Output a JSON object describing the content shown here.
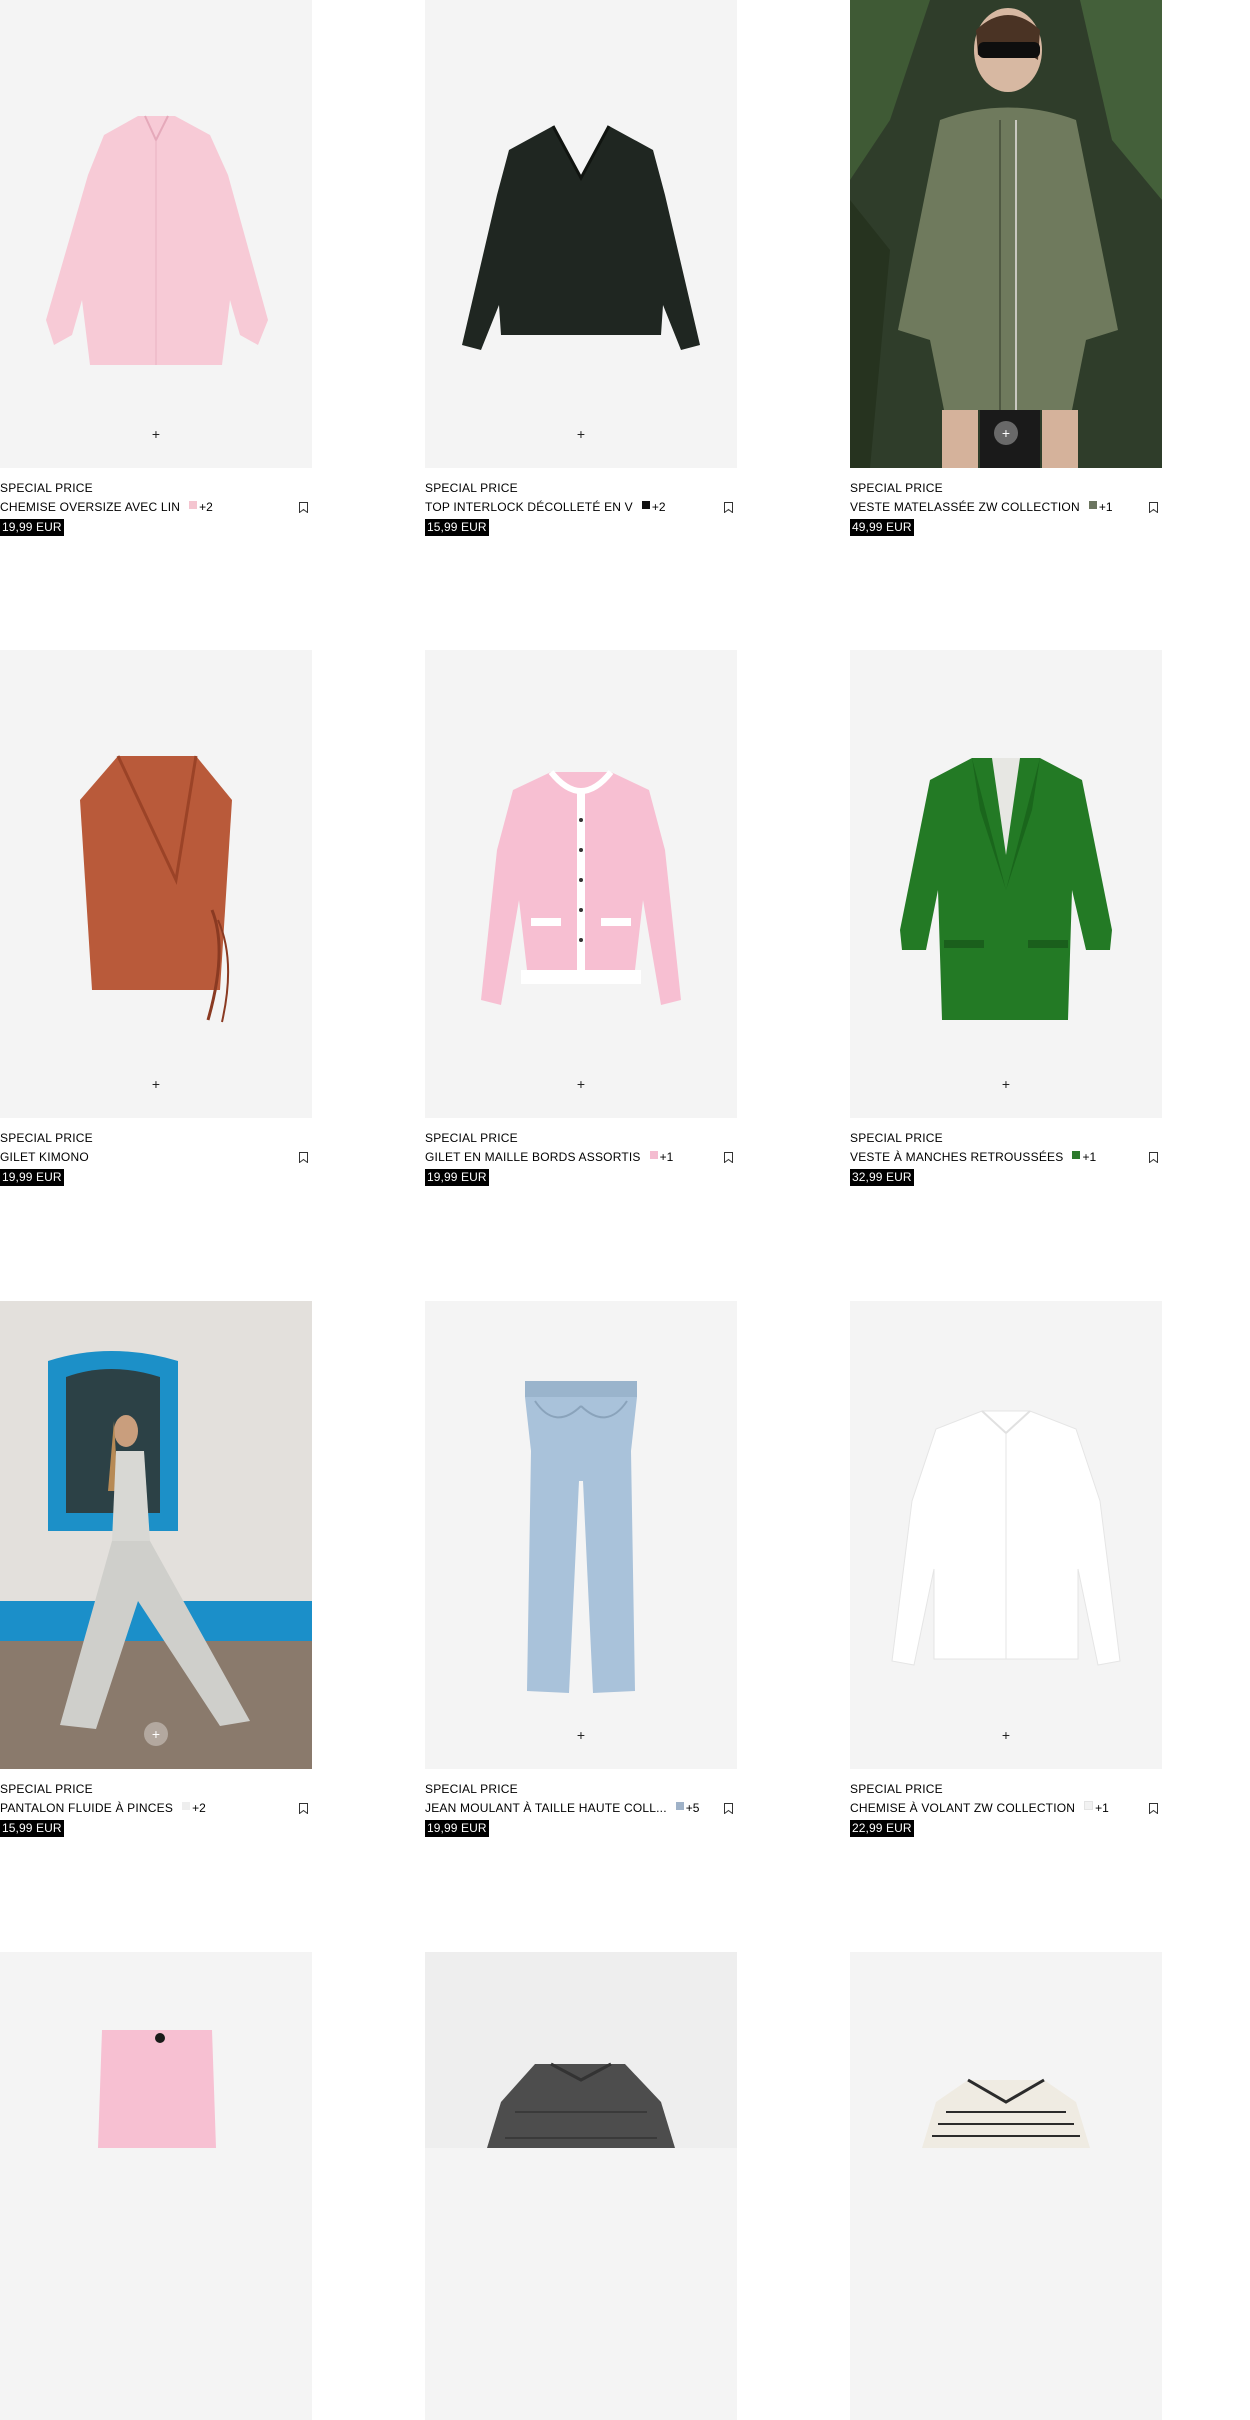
{
  "products": [
    {
      "label": "SPECIAL PRICE",
      "name": "CHEMISE OVERSIZE AVEC LIN",
      "swatch_color": "#f4c5d0",
      "more_colors": "+2",
      "price": "19,99 EUR",
      "image_kind": "pink-shirt",
      "bg": "#f4f4f4"
    },
    {
      "label": "SPECIAL PRICE",
      "name": "TOP INTERLOCK DÉCOLLETÉ EN V",
      "swatch_color": "#111111",
      "more_colors": "+2",
      "price": "15,99 EUR",
      "image_kind": "black-top",
      "bg": "#f4f4f4"
    },
    {
      "label": "SPECIAL PRICE",
      "name": "VESTE MATELASSÉE ZW COLLECTION",
      "swatch_color": "#6b7560",
      "more_colors": "+1",
      "price": "49,99 EUR",
      "image_kind": "model-quilted-jacket",
      "bg": "#3d4a34"
    },
    {
      "label": "SPECIAL PRICE",
      "name": "GILET KIMONO",
      "swatch_color": "",
      "more_colors": "",
      "price": "19,99 EUR",
      "image_kind": "rust-vest",
      "bg": "#f4f4f4"
    },
    {
      "label": "SPECIAL PRICE",
      "name": "GILET EN MAILLE BORDS ASSORTIS",
      "swatch_color": "#f4bcd0",
      "more_colors": "+1",
      "price": "19,99 EUR",
      "image_kind": "pink-cardigan",
      "bg": "#f4f4f4"
    },
    {
      "label": "SPECIAL PRICE",
      "name": "VESTE À MANCHES RETROUSSÉES",
      "swatch_color": "#2d7a2d",
      "more_colors": "+1",
      "price": "32,99 EUR",
      "image_kind": "green-blazer",
      "bg": "#f4f4f4"
    },
    {
      "label": "SPECIAL PRICE",
      "name": "PANTALON FLUIDE À PINCES",
      "swatch_color": "#eeeeee",
      "more_colors": "+2",
      "price": "15,99 EUR",
      "image_kind": "model-wide-pants",
      "bg": "#e8e6e3"
    },
    {
      "label": "SPECIAL PRICE",
      "name": "JEAN MOULANT À TAILLE HAUTE COLL...",
      "swatch_color": "#9fb2c8",
      "more_colors": "+5",
      "price": "19,99 EUR",
      "image_kind": "jeans",
      "bg": "#f4f4f4"
    },
    {
      "label": "SPECIAL PRICE",
      "name": "CHEMISE À VOLANT ZW COLLECTION",
      "swatch_color": "#f2f2f2",
      "more_colors": "+1",
      "price": "22,99 EUR",
      "image_kind": "white-shirt",
      "bg": "#f4f4f4"
    },
    {
      "label": "",
      "name": "",
      "swatch_color": "",
      "more_colors": "",
      "price": "",
      "image_kind": "pink-pants",
      "bg": "#f4f4f4"
    },
    {
      "label": "",
      "name": "",
      "swatch_color": "",
      "more_colors": "",
      "price": "",
      "image_kind": "puffer-jacket",
      "bg": "#eeeeee"
    },
    {
      "label": "",
      "name": "",
      "swatch_color": "",
      "more_colors": "",
      "price": "",
      "image_kind": "striped-shirt",
      "bg": "#f4f4f4"
    }
  ],
  "icons": {
    "add": "plus-icon",
    "wishlist": "bookmark-icon"
  },
  "add_symbol": "+"
}
